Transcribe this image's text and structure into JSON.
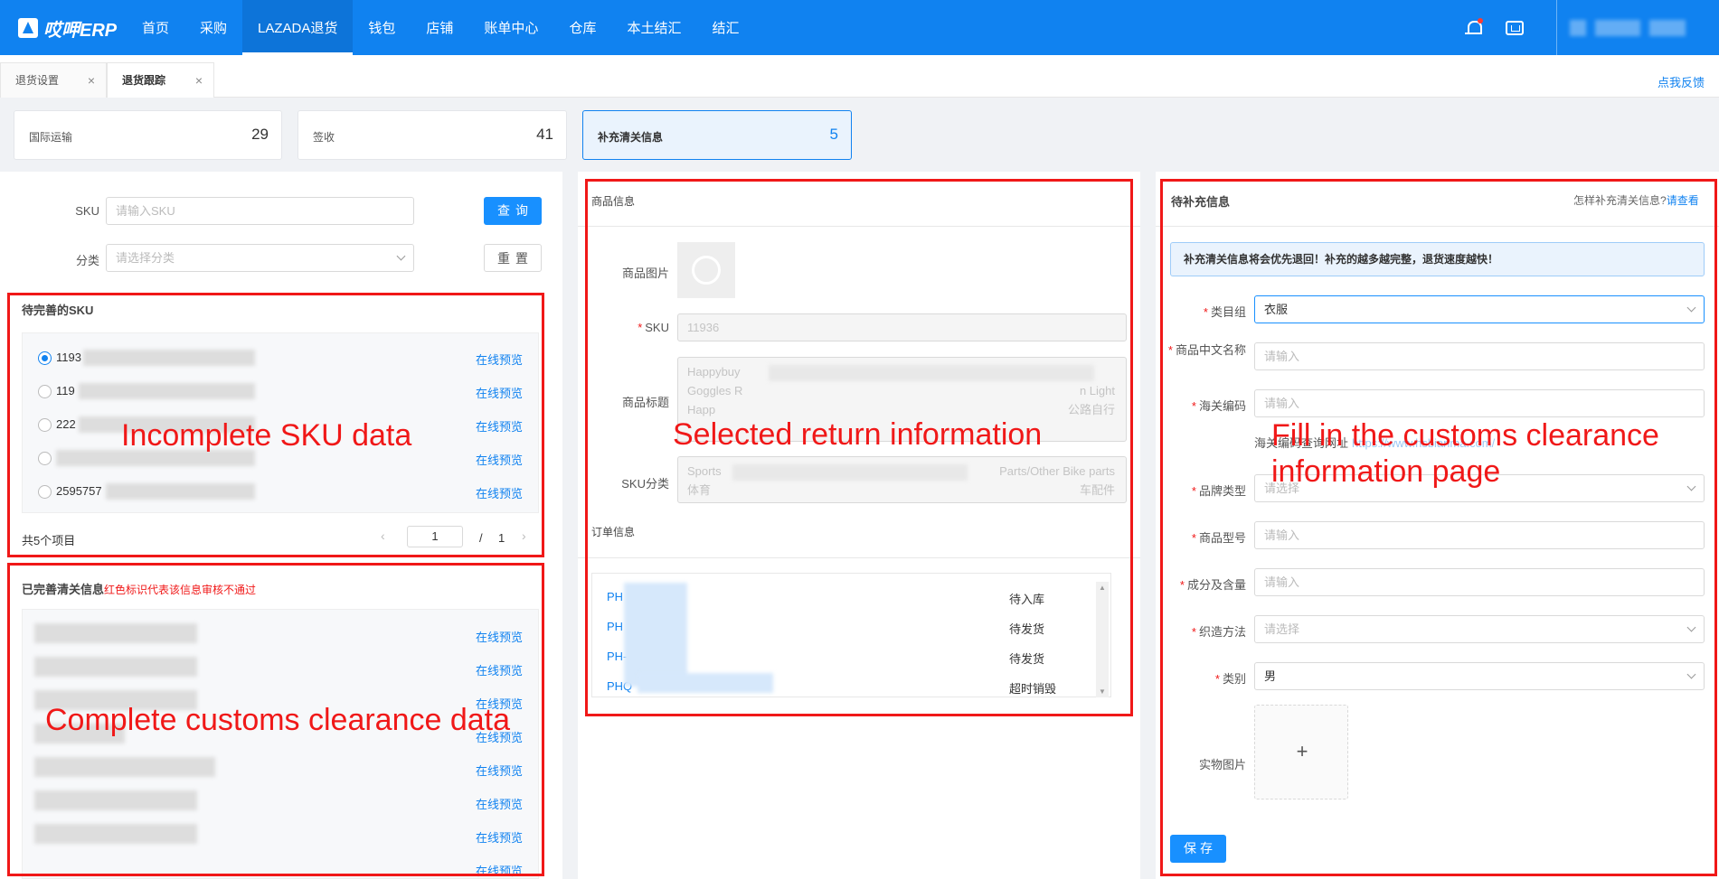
{
  "header": {
    "logo": "哎呷ERP",
    "nav": [
      "首页",
      "采购",
      "LAZADA退货",
      "钱包",
      "店铺",
      "账单中心",
      "仓库",
      "本土结汇",
      "结汇"
    ],
    "active_nav": "LAZADA退货"
  },
  "tabs": [
    {
      "label": "退货设置",
      "close": "×"
    },
    {
      "label": "退货跟踪",
      "close": "×"
    }
  ],
  "feedback_link": "点我反馈",
  "stats": [
    {
      "label": "国际运输",
      "value": "29"
    },
    {
      "label": "签收",
      "value": "41"
    },
    {
      "label": "补充清关信息",
      "value": "5"
    }
  ],
  "left": {
    "sku_label": "SKU",
    "sku_placeholder": "请输入SKU",
    "category_label": "分类",
    "category_placeholder": "请选择分类",
    "search_button": "查询",
    "reset_button": "重置",
    "pending_title": "待完善的SKU",
    "pending_items": [
      {
        "sku": "1193",
        "link": "在线预览"
      },
      {
        "sku": "119",
        "link": "在线预览"
      },
      {
        "sku": "222",
        "link": "在线预览"
      },
      {
        "sku": "",
        "link": "在线预览"
      },
      {
        "sku": "2595757",
        "link": "在线预览"
      }
    ],
    "total_text": "共5个项目",
    "page_current": "1",
    "page_sep": "/",
    "page_total": "1",
    "done_title": "已完善清关信息",
    "done_note": "红色标识代表该信息审核不通过",
    "done_links": [
      "在线预览",
      "在线预览",
      "在线预览",
      "在线预览",
      "在线预览",
      "在线预览",
      "在线预览",
      "在线预览"
    ]
  },
  "middle": {
    "product_section": "商品信息",
    "image_label": "商品图片",
    "sku_label": "SKU",
    "sku_value": "11936",
    "title_label": "商品标题",
    "title_lines": [
      "Happybuy",
      "Goggles R",
      "Happ"
    ],
    "title_right": [
      "n Light",
      "公路自行"
    ],
    "category_label": "SKU分类",
    "category_lines": [
      "Sports",
      "体育"
    ],
    "category_right": [
      "Parts/Other Bike parts",
      "车配件"
    ],
    "order_section": "订单信息",
    "orders": [
      {
        "id": "PH",
        "status": "待入库"
      },
      {
        "id": "PH",
        "status": "待发货"
      },
      {
        "id": "PH-",
        "status": "待发货"
      },
      {
        "id": "PHQ",
        "status": "超时销毁"
      }
    ]
  },
  "right": {
    "title": "待补充信息",
    "help_text": "怎样补充清关信息?",
    "help_link": "请查看",
    "notice": "补充清关信息将会优先退回！补充的越多越完整，退货速度越快！",
    "fields": [
      {
        "label": "类目组",
        "value": "衣服",
        "type": "select",
        "filled": true
      },
      {
        "label": "商品中文名称",
        "value": "请输入",
        "type": "input",
        "filled": false
      },
      {
        "label": "海关编码",
        "value": "请输入",
        "type": "input",
        "filled": false
      },
      {
        "label": "品牌类型",
        "value": "请选择",
        "type": "select",
        "filled": false
      },
      {
        "label": "商品型号",
        "value": "请输入",
        "type": "input",
        "filled": false
      },
      {
        "label": "成分及含量",
        "value": "请输入",
        "type": "input",
        "filled": false
      },
      {
        "label": "织造方法",
        "value": "请选择",
        "type": "select",
        "filled": false
      },
      {
        "label": "类别",
        "value": "男",
        "type": "select",
        "filled": true
      }
    ],
    "hs_lookup": "海关编码查询网址",
    "hs_url": "https://www.hsbianma.com/",
    "photo_label": "实物图片",
    "photo_plus": "+",
    "save_button": "保存"
  },
  "annotations": {
    "incomplete": "Incomplete SKU data",
    "complete": "Complete customs clearance data",
    "selected": "Selected return information",
    "fill_1": "Fill in the customs clearance",
    "fill_2": "information page"
  },
  "colors": {
    "brand": "#1082f0",
    "annotation": "#f01818"
  }
}
